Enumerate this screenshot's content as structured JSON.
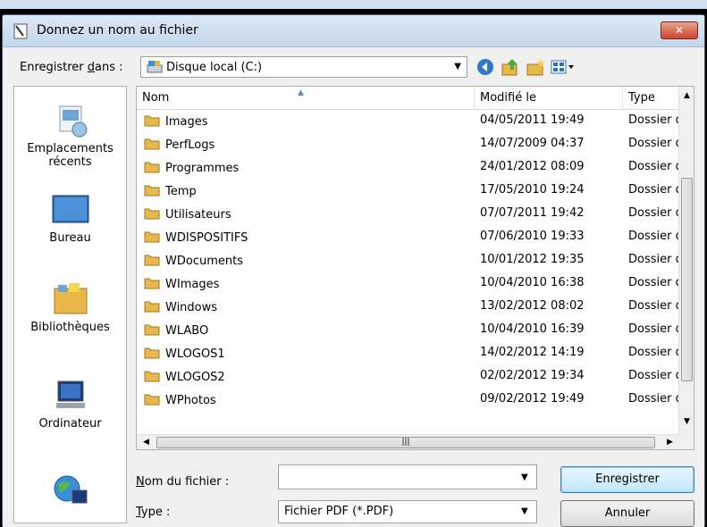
{
  "window": {
    "title": "Donnez un nom au fichier",
    "close_label": "✕"
  },
  "toolbar": {
    "save_in_label": "Enregistrer dans :",
    "save_in_value": "Disque local (C:)"
  },
  "places": [
    {
      "label1": "Emplacements",
      "label2": "récents",
      "icon": "recent-places-icon"
    },
    {
      "label1": "Bureau",
      "label2": "",
      "icon": "desktop-icon"
    },
    {
      "label1": "Bibliothèques",
      "label2": "",
      "icon": "libraries-icon"
    },
    {
      "label1": "Ordinateur",
      "label2": "",
      "icon": "computer-icon"
    },
    {
      "label1": "",
      "label2": "",
      "icon": "network-icon"
    }
  ],
  "columns": {
    "name": "Nom",
    "modified": "Modifié le",
    "type": "Type"
  },
  "files": [
    {
      "name": "Images",
      "date": "04/05/2011 19:49",
      "type": "Dossier de fichiers"
    },
    {
      "name": "PerfLogs",
      "date": "14/07/2009 04:37",
      "type": "Dossier de fichiers"
    },
    {
      "name": "Programmes",
      "date": "24/01/2012 08:09",
      "type": "Dossier de fichiers"
    },
    {
      "name": "Temp",
      "date": "17/05/2010 19:24",
      "type": "Dossier de fichiers"
    },
    {
      "name": "Utilisateurs",
      "date": "07/07/2011 19:42",
      "type": "Dossier de fichiers"
    },
    {
      "name": "WDISPOSITIFS",
      "date": "07/06/2010 19:33",
      "type": "Dossier de fichiers"
    },
    {
      "name": "WDocuments",
      "date": "10/01/2012 19:35",
      "type": "Dossier de fichiers"
    },
    {
      "name": "WImages",
      "date": "10/04/2010 16:38",
      "type": "Dossier de fichiers"
    },
    {
      "name": "Windows",
      "date": "13/02/2012 08:02",
      "type": "Dossier de fichiers"
    },
    {
      "name": "WLABO",
      "date": "10/04/2010 16:39",
      "type": "Dossier de fichiers"
    },
    {
      "name": "WLOGOS1",
      "date": "14/02/2012 14:19",
      "type": "Dossier de fichiers"
    },
    {
      "name": "WLOGOS2",
      "date": "02/02/2012 19:34",
      "type": "Dossier de fichiers"
    },
    {
      "name": "WPhotos",
      "date": "09/02/2012 19:49",
      "type": "Dossier de fichiers"
    }
  ],
  "form": {
    "filename_label": "Nom du fichier :",
    "filename_value": "",
    "type_label": "Type :",
    "type_value": "Fichier PDF (*.PDF)"
  },
  "buttons": {
    "save": "Enregistrer",
    "cancel": "Annuler"
  },
  "colors": {
    "folder": "#e8b84a",
    "accent": "#3c7fb1"
  }
}
